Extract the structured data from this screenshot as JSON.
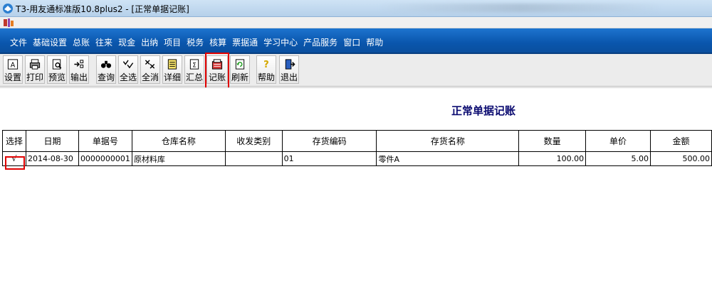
{
  "window": {
    "title": "T3-用友通标准版10.8plus2 - [正常单据记账]"
  },
  "menu": [
    "文件",
    "基础设置",
    "总账",
    "往来",
    "现金",
    "出纳",
    "项目",
    "税务",
    "核算",
    "票据通",
    "学习中心",
    "产品服务",
    "窗口",
    "帮助"
  ],
  "toolbar": {
    "setup": "设置",
    "print": "打印",
    "preview": "预览",
    "export": "输出",
    "query": "查询",
    "select_all": "全选",
    "deselect_all": "全消",
    "detail": "详细",
    "summary": "汇总",
    "post": "记账",
    "refresh": "刷新",
    "help": "帮助",
    "exit": "退出"
  },
  "page": {
    "title": "正常单据记账"
  },
  "table": {
    "headers": [
      "选择",
      "日期",
      "单据号",
      "仓库名称",
      "收发类别",
      "存货编码",
      "存货名称",
      "数量",
      "单价",
      "金额"
    ],
    "rows": [
      {
        "select": "√",
        "date": "2014-08-30",
        "doc_no": "0000000001",
        "warehouse": "原材料库",
        "category": "",
        "code": "01",
        "name": "零件A",
        "qty": "100.00",
        "price": "5.00",
        "amount": "500.00"
      }
    ]
  },
  "colors": {
    "menu_bg": "#0a56ad",
    "title_text": "#0a0a70",
    "highlight": "#e00000"
  }
}
